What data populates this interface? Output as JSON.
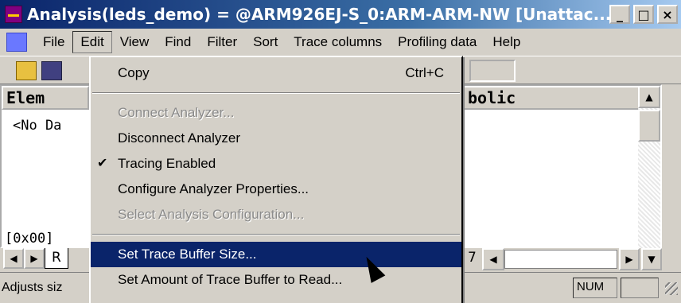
{
  "window": {
    "title": "Analysis(leds_demo) = @ARM926EJ-S_0:ARM-ARM-NW [Unattac...",
    "buttons": {
      "minimize": "_",
      "maximize": "□",
      "close": "×"
    }
  },
  "menubar": {
    "items": [
      "File",
      "Edit",
      "View",
      "Find",
      "Filter",
      "Sort",
      "Trace columns",
      "Profiling data",
      "Help"
    ],
    "active": "Edit"
  },
  "table": {
    "columns": [
      "Elem",
      "bolic"
    ],
    "empty_text": "<No Da",
    "address": "[0x00]"
  },
  "bottom": {
    "tab_label": "R",
    "tab_extra": "7"
  },
  "status": {
    "text": "Adjusts siz",
    "num": "NUM"
  },
  "edit_menu": {
    "items": [
      {
        "label": "Copy",
        "shortcut": "Ctrl+C"
      },
      {
        "label": "Connect Analyzer..."
      },
      {
        "label": "Disconnect Analyzer"
      },
      {
        "label": "Tracing Enabled"
      },
      {
        "label": "Configure Analyzer Properties..."
      },
      {
        "label": "Select Analysis Configuration..."
      },
      {
        "label": "Set Trace Buffer Size..."
      },
      {
        "label": "Set Amount of Trace Buffer to Read..."
      }
    ]
  }
}
